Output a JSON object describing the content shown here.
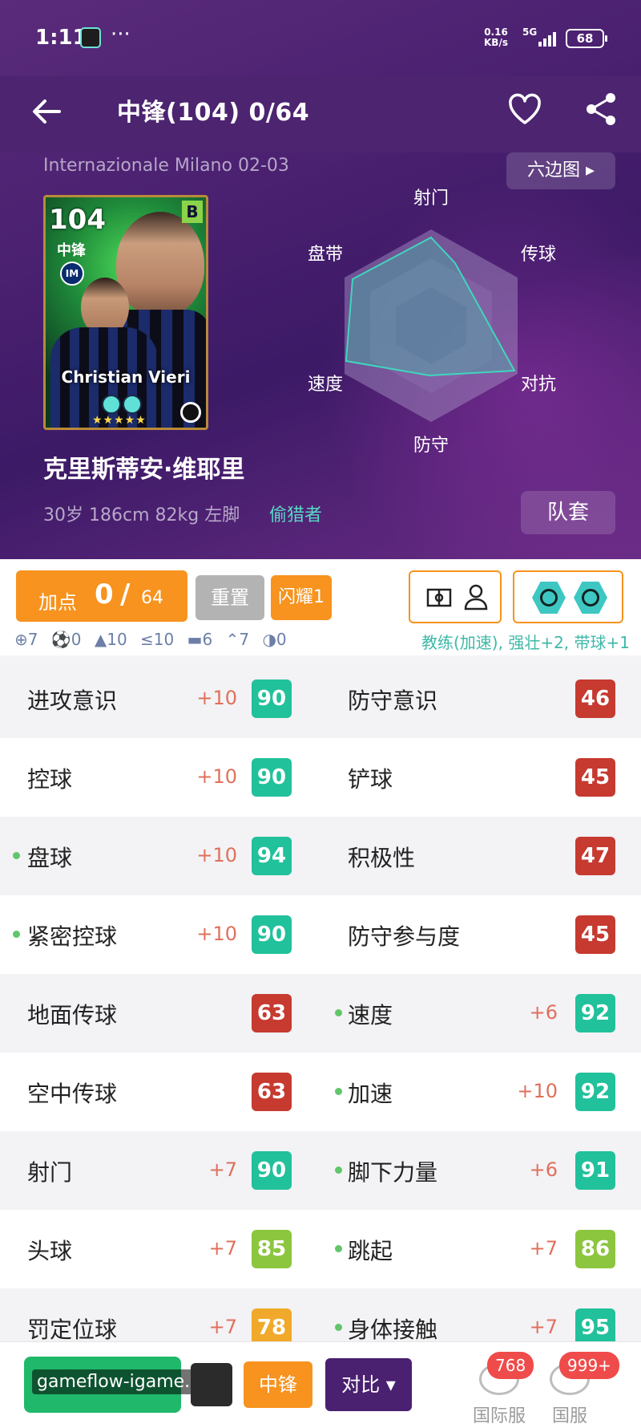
{
  "status_bar": {
    "time": "1:11",
    "dots": "···",
    "net_speed_value": "0.16",
    "net_speed_unit": "KB/s",
    "network": "5G",
    "battery": "68"
  },
  "nav": {
    "title": "中锋(104)  0/64"
  },
  "hero": {
    "club": "Internazionale Milano 02-03",
    "hex_button": "六边图 ▸",
    "card": {
      "rating": "104",
      "position": "中锋",
      "grade": "B",
      "name": "Christian Vieri",
      "stars": "★★★★★"
    },
    "player_name": "克里斯蒂安·维耶里",
    "info": "30岁 186cm 82kg 左脚",
    "tag": "偷猎者",
    "kit_button": "队套"
  },
  "radar": {
    "labels": [
      "射门",
      "传球",
      "对抗",
      "防守",
      "速度",
      "盘带"
    ]
  },
  "controls": {
    "plus_label": "加点",
    "plus_current": "0",
    "plus_sep": "/",
    "plus_total": "64",
    "reset": "重置",
    "shine": "闪耀1",
    "mini_stats": [
      "⊕7",
      "⚽0",
      "▲10",
      "≤10",
      "▬6",
      "⌃7",
      "◑0"
    ],
    "coach_note": "教练(加速), 强壮+2, 带球+1"
  },
  "stats": [
    {
      "left": {
        "label": "进攻意识",
        "bonus": "+10",
        "value": "90",
        "color": "teal",
        "dot": false
      },
      "right": {
        "label": "防守意识",
        "bonus": "",
        "value": "46",
        "color": "red",
        "dot": false
      }
    },
    {
      "left": {
        "label": "控球",
        "bonus": "+10",
        "value": "90",
        "color": "teal",
        "dot": false
      },
      "right": {
        "label": "铲球",
        "bonus": "",
        "value": "45",
        "color": "red",
        "dot": false
      }
    },
    {
      "left": {
        "label": "盘球",
        "bonus": "+10",
        "value": "94",
        "color": "teal",
        "dot": true
      },
      "right": {
        "label": "积极性",
        "bonus": "",
        "value": "47",
        "color": "red",
        "dot": false
      }
    },
    {
      "left": {
        "label": "紧密控球",
        "bonus": "+10",
        "value": "90",
        "color": "teal",
        "dot": true
      },
      "right": {
        "label": "防守参与度",
        "bonus": "",
        "value": "45",
        "color": "red",
        "dot": false
      }
    },
    {
      "left": {
        "label": "地面传球",
        "bonus": "",
        "value": "63",
        "color": "red",
        "dot": false
      },
      "right": {
        "label": "速度",
        "bonus": "+6",
        "value": "92",
        "color": "teal",
        "dot": true
      }
    },
    {
      "left": {
        "label": "空中传球",
        "bonus": "",
        "value": "63",
        "color": "red",
        "dot": false
      },
      "right": {
        "label": "加速",
        "bonus": "+10",
        "value": "92",
        "color": "teal",
        "dot": true
      }
    },
    {
      "left": {
        "label": "射门",
        "bonus": "+7",
        "value": "90",
        "color": "teal",
        "dot": false
      },
      "right": {
        "label": "脚下力量",
        "bonus": "+6",
        "value": "91",
        "color": "teal",
        "dot": true
      }
    },
    {
      "left": {
        "label": "头球",
        "bonus": "+7",
        "value": "85",
        "color": "lime",
        "dot": false
      },
      "right": {
        "label": "跳起",
        "bonus": "+7",
        "value": "86",
        "color": "lime",
        "dot": true
      }
    },
    {
      "left": {
        "label": "罚定位球",
        "bonus": "+7",
        "value": "78",
        "color": "yellow",
        "dot": false
      },
      "right": {
        "label": "身体接触",
        "bonus": "+7",
        "value": "95",
        "color": "teal",
        "dot": true
      }
    }
  ],
  "bottom": {
    "watermark": "gameflow-igame.com",
    "position_button": "中锋",
    "compare_button": "对比 ▾",
    "chats": [
      {
        "name": "国际服",
        "badge": "768"
      },
      {
        "name": "国服",
        "badge": "999+"
      }
    ]
  },
  "colors": {
    "teal": "#21c19b",
    "red": "#c63a30",
    "lime": "#8cc63f",
    "yellow": "#f0a92a",
    "orange": "#f7931e",
    "purple": "#4a2070"
  }
}
